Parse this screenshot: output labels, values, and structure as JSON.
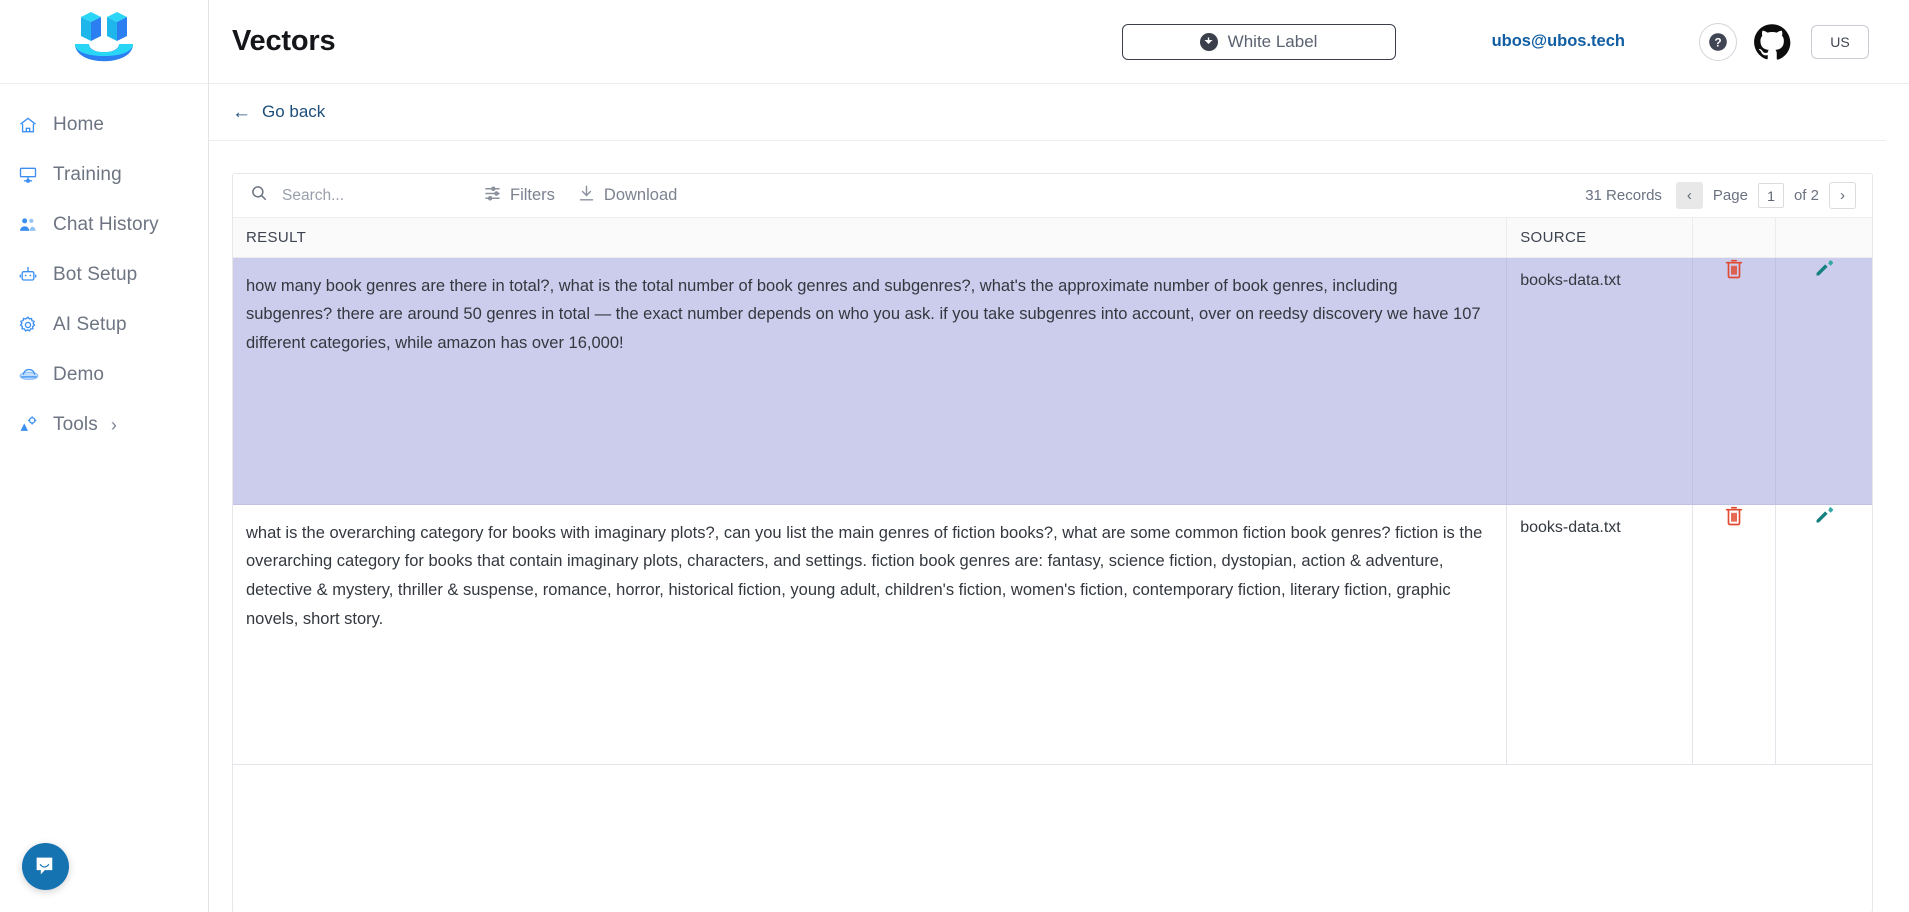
{
  "sidebar": {
    "logo_name": "ubos-smiley-logo",
    "items": [
      {
        "label": "Home",
        "icon": "home-icon"
      },
      {
        "label": "Training",
        "icon": "training-icon"
      },
      {
        "label": "Chat History",
        "icon": "chat-history-icon"
      },
      {
        "label": "Bot Setup",
        "icon": "robot-icon"
      },
      {
        "label": "AI Setup",
        "icon": "gear-icon"
      },
      {
        "label": "Demo",
        "icon": "demo-icon"
      },
      {
        "label": "Tools",
        "icon": "tools-icon",
        "chevron": "›"
      }
    ],
    "intercom_label": "intercom-launcher"
  },
  "header": {
    "title": "Vectors",
    "white_label_button": "White Label",
    "user_email": "ubos@ubos.tech",
    "help_glyph": "?",
    "language": "US"
  },
  "back": {
    "label": "Go back",
    "arrow": "←"
  },
  "toolbar": {
    "search_placeholder": "Search...",
    "search_value": "",
    "filters_label": "Filters",
    "download_label": "Download"
  },
  "pagination": {
    "records": "31 Records",
    "prev_glyph": "‹",
    "page_label": "Page",
    "page_value": "1",
    "of_label": "of 2",
    "next_glyph": "›"
  },
  "table": {
    "columns": [
      "RESULT",
      "SOURCE",
      "",
      ""
    ],
    "rows": [
      {
        "result": "how many book genres are there in total?, what is the total number of book genres and subgenres?, what's the approximate number of book genres, including subgenres? there are around 50 genres in total — the exact number depends on who you ask. if you take subgenres into account, over on reedsy discovery we have 107 different categories, while amazon has over 16,000!",
        "source": "books-data.txt",
        "selected": true,
        "delete_icon": "trash-icon",
        "edit_icon": "pencil-icon"
      },
      {
        "result": "what is the overarching category for books with imaginary plots?, can you list the main genres of fiction books?, what are some common fiction book genres? fiction is the overarching category for books that contain imaginary plots, characters, and settings. fiction book genres are: fantasy, science fiction, dystopian, action & adventure, detective & mystery, thriller & suspense, romance, horror, historical fiction, young adult, children's fiction, women's fiction, contemporary fiction, literary fiction, graphic novels, short story.",
        "source": "books-data.txt",
        "selected": false,
        "delete_icon": "trash-icon",
        "edit_icon": "pencil-icon"
      }
    ]
  },
  "colors": {
    "accent_blue": "#3b8ff0",
    "link_blue": "#115ea3",
    "selected_row": "#ccccec",
    "delete_red": "#e14b32",
    "edit_teal": "#1a8a8a",
    "intercom_blue": "#1673b1"
  }
}
